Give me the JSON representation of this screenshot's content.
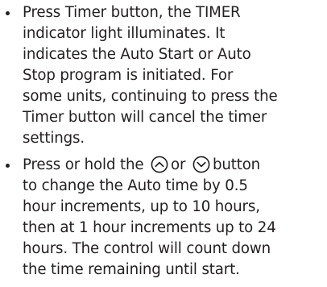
{
  "bullets": [
    {
      "lines": [
        "Press Timer button, the TIMER",
        "indicator light illuminates. It",
        "indicates the Auto Start or Auto",
        "Stop program is initiated. For",
        "some units, continuing to press the",
        "Timer button will cancel the timer",
        "settings."
      ]
    },
    {
      "line0": {
        "before": "Press or hold the",
        "middle": "or",
        "after": "button"
      },
      "lines": [
        "to change the Auto time by 0.5",
        "hour increments, up to 10 hours,",
        "then at 1 hour increments up to 24",
        "hours. The control will count down",
        "the time remaining until start."
      ]
    }
  ],
  "icons": {
    "up": "chevron-up-circle-icon",
    "down": "chevron-down-circle-icon"
  }
}
